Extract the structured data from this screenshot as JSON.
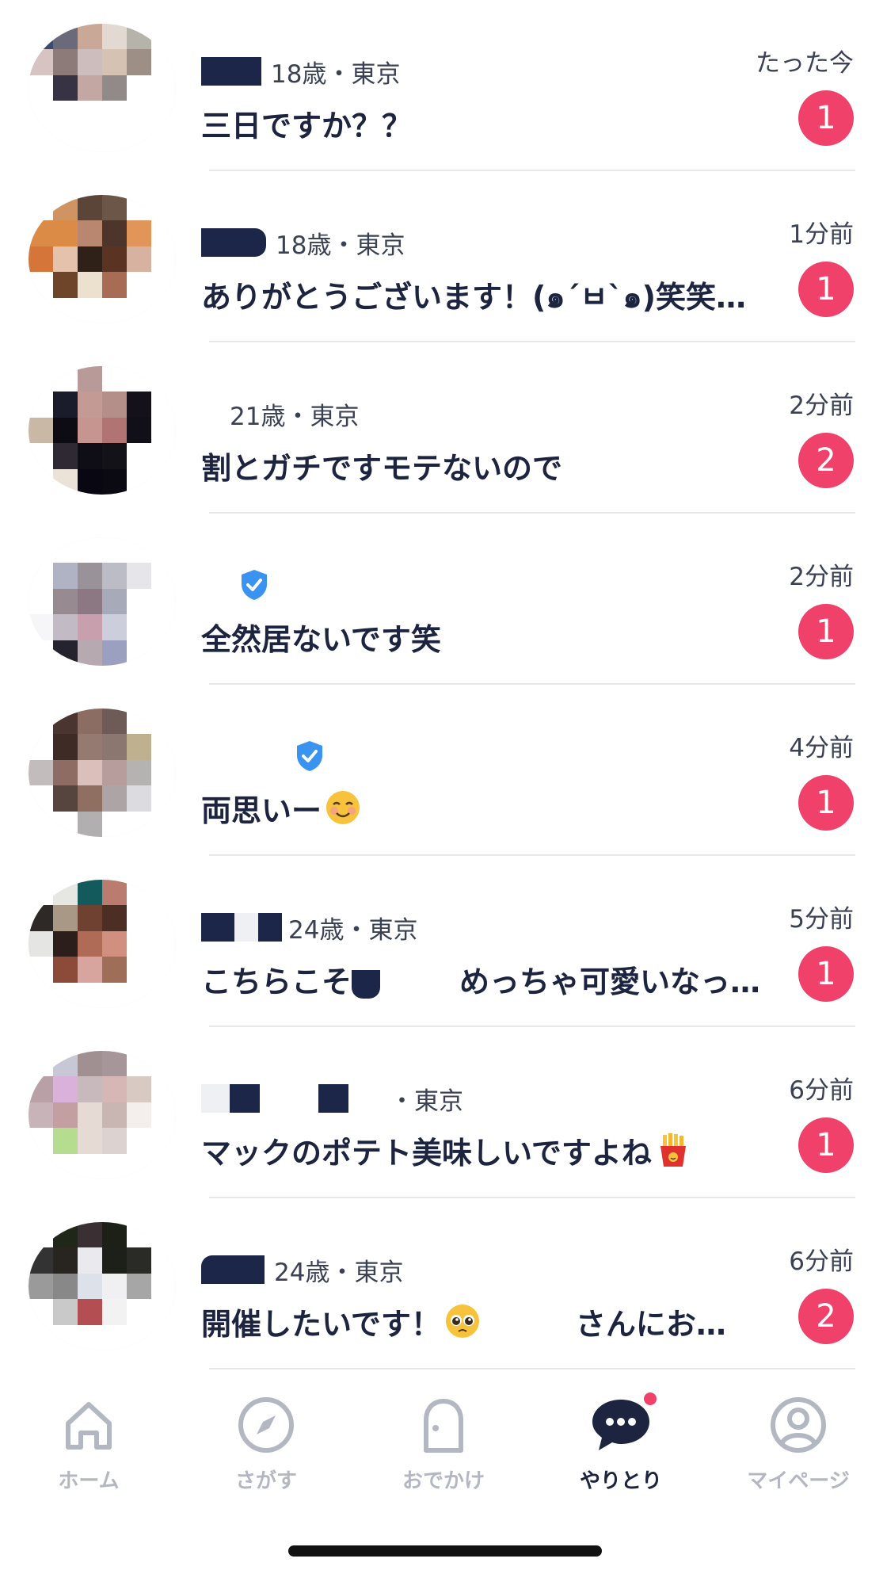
{
  "colors": {
    "badge": "#f0416a",
    "text_primary": "#1c2440",
    "text_secondary": "#3b4154",
    "tab_inactive": "#b3b7c2",
    "divider": "#e7e8ec",
    "verified": "#3a93f0"
  },
  "messages": [
    {
      "meta": "18歳・東京",
      "text": "三日ですか？？",
      "time": "たった今",
      "unread": "1"
    },
    {
      "meta": "18歳・東京",
      "text": "ありがとうございます！(๑´ㅂ`๑)笑笑…",
      "time": "1分前",
      "unread": "1"
    },
    {
      "meta": "21歳・東京",
      "text": "割とガチですモテないので",
      "time": "2分前",
      "unread": "2"
    },
    {
      "meta": "",
      "text": "全然居ないです笑",
      "time": "2分前",
      "unread": "1",
      "verified": true
    },
    {
      "meta": "",
      "text": "両思いー",
      "time": "4分前",
      "unread": "1",
      "verified": true,
      "emoji": "smiling-face-icon"
    },
    {
      "meta": "24歳・東京",
      "text_a": "こちらこそ",
      "text_b": "めっちゃ可愛いなっ…",
      "time": "5分前",
      "unread": "1"
    },
    {
      "meta": "・東京",
      "text": "マックのポテト美味しいですよね",
      "time": "6分前",
      "unread": "1",
      "emoji": "french-fries-icon"
    },
    {
      "meta": "24歳・東京",
      "text_a": "開催したいです！",
      "text_b": "さんにお…",
      "time": "6分前",
      "unread": "2",
      "emoji": "pleading-face-icon"
    }
  ],
  "tabbar": {
    "home": "ホーム",
    "search": "さがす",
    "outing": "おでかけ",
    "chat": "やりとり",
    "mypage": "マイページ"
  }
}
